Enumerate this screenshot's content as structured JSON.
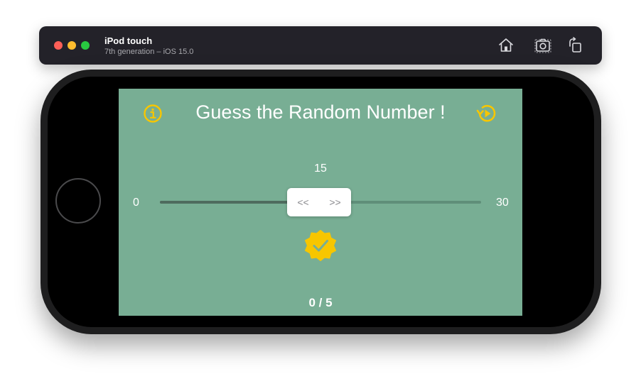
{
  "simulator": {
    "device_name": "iPod touch",
    "device_subtitle": "7th generation – iOS 15.0",
    "toolbar_icons": [
      "home-icon",
      "screenshot-icon",
      "rotate-icon"
    ]
  },
  "app": {
    "title": "Guess the Random Number !",
    "slider": {
      "current_label": "15",
      "min_label": "0",
      "max_label": "30",
      "value": 15,
      "min": 0,
      "max": 30,
      "thumb_left": "<<",
      "thumb_right": ">>"
    },
    "score": "0 / 5",
    "icons": {
      "info": "info-circle-icon",
      "restart": "restart-icon",
      "check": "checkmark-seal-icon"
    },
    "colors": {
      "background": "#78ae94",
      "accent": "#f7c600",
      "text": "#ffffff"
    }
  }
}
